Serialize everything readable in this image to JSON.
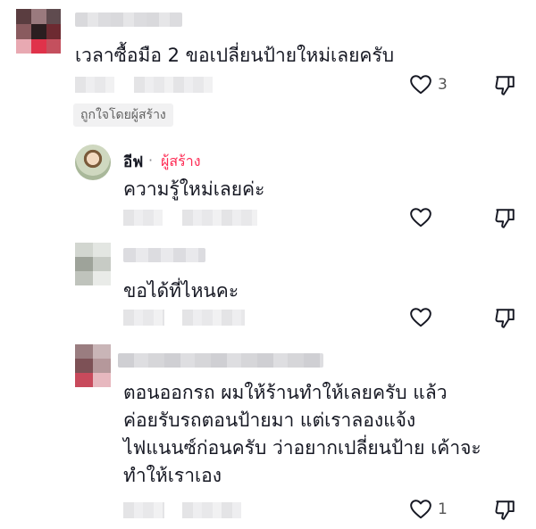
{
  "comments": [
    {
      "text": "เวลาซื้อมือ 2 ขอเปลี่ยนป้ายใหม่เลยครับ",
      "likes": "3",
      "liked_by_creator": "ถูกใจโดยผู้สร้าง"
    },
    {
      "author": "อีฟ",
      "separator": "·",
      "creator_label": "ผู้สร้าง",
      "text": "ความรู้ใหม่เลยค่ะ",
      "likes": ""
    },
    {
      "text": "ขอได้ที่ไหนคะ",
      "likes": ""
    },
    {
      "text_lines": [
        "ตอนออกรถ ผมให้ร้านทำให้เลยครับ แล้ว",
        "ค่อยรับรถตอนป้ายมา แต่เราลองแจ้ง",
        "ไฟแนนซ์ก่อนครับ ว่าอยากเปลี่ยนป้าย เค้าจะ",
        "ทำให้เราเอง"
      ],
      "likes": "1"
    }
  ],
  "icons": {
    "like": "heart-outline-icon",
    "dislike": "thumbs-down-outline-icon"
  },
  "colors": {
    "creator": "#fe2c55",
    "text": "#161823",
    "muted": "#606060"
  }
}
